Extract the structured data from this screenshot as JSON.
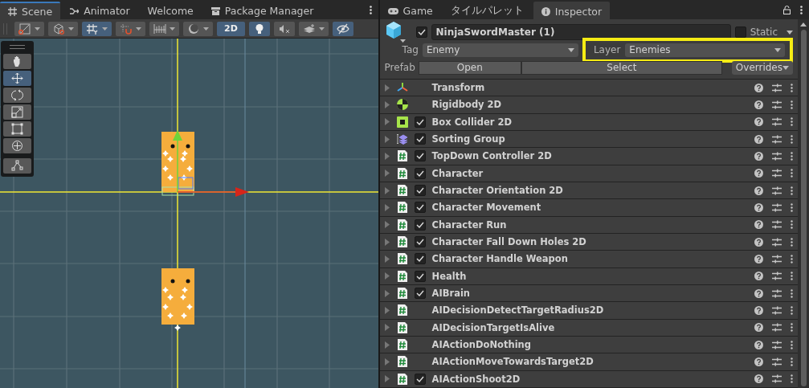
{
  "scene_panel": {
    "tabs": [
      {
        "label": "Scene",
        "kind": "grid",
        "selected": true
      },
      {
        "label": "Animator",
        "kind": "animator",
        "selected": false
      },
      {
        "label": "Welcome",
        "kind": "plain",
        "selected": false
      },
      {
        "label": "Package Manager",
        "kind": "package",
        "selected": false
      }
    ],
    "toolbar": [
      {
        "kind": "draw-mode",
        "selected": false
      },
      {
        "kind": "gizmo-cube",
        "selected": false
      },
      {
        "kind": "grid-snap",
        "selected": true
      },
      {
        "kind": "increment-snap",
        "selected": false
      },
      {
        "kind": "ruler",
        "selected": false
      },
      {
        "kind": "shading",
        "selected": false
      },
      {
        "kind": "mode",
        "label": "2D",
        "selected": true
      },
      {
        "kind": "lighting",
        "selected": true
      },
      {
        "kind": "audio",
        "selected": false
      },
      {
        "kind": "effects",
        "selected": false
      },
      {
        "kind": "visibility",
        "selected": true
      }
    ],
    "tools": [
      {
        "kind": "hand",
        "selected": false
      },
      {
        "kind": "move",
        "selected": true
      },
      {
        "kind": "rotate",
        "selected": false
      },
      {
        "kind": "scale",
        "selected": false
      },
      {
        "kind": "rect",
        "selected": false
      },
      {
        "kind": "transform",
        "selected": false
      },
      {
        "kind": "custom",
        "selected": false
      }
    ]
  },
  "inspector_panel": {
    "tabs": [
      {
        "label": "Game",
        "kind": "game",
        "selected": false
      },
      {
        "label": "タイルパレット",
        "kind": "plain",
        "selected": false
      },
      {
        "label": "Inspector",
        "kind": "info",
        "selected": true
      }
    ],
    "object": {
      "active": true,
      "name": "NinjaSwordMaster (1)",
      "static": false,
      "static_label": "Static",
      "tag_label": "Tag",
      "tag": "Enemy",
      "layer_label": "Layer",
      "layer": "Enemies",
      "layer_highlighted": true,
      "prefab_label": "Prefab",
      "open_button": "Open",
      "select_button": "Select",
      "overrides": "Overrides"
    },
    "components": [
      {
        "name": "Transform",
        "kind": "transform",
        "checked": false
      },
      {
        "name": "Rigidbody 2D",
        "kind": "rigidbody",
        "checked": false
      },
      {
        "name": "Box Collider 2D",
        "kind": "collider",
        "checked": true
      },
      {
        "name": "Sorting Group",
        "kind": "sorting",
        "checked": true
      },
      {
        "name": "TopDown Controller 2D",
        "kind": "script",
        "checked": true
      },
      {
        "name": "Character",
        "kind": "script",
        "checked": true
      },
      {
        "name": "Character Orientation 2D",
        "kind": "script",
        "checked": true
      },
      {
        "name": "Character Movement",
        "kind": "script",
        "checked": true
      },
      {
        "name": "Character Run",
        "kind": "script",
        "checked": true
      },
      {
        "name": "Character Fall Down Holes 2D",
        "kind": "script",
        "checked": true
      },
      {
        "name": "Character Handle Weapon",
        "kind": "script",
        "checked": true
      },
      {
        "name": "Health",
        "kind": "script",
        "checked": true
      },
      {
        "name": "AIBrain",
        "kind": "script",
        "checked": true
      },
      {
        "name": "AIDecisionDetectTargetRadius2D",
        "kind": "script",
        "checked": false
      },
      {
        "name": "AIDecisionTargetIsAlive",
        "kind": "script",
        "checked": false
      },
      {
        "name": "AIActionDoNothing",
        "kind": "script",
        "checked": false
      },
      {
        "name": "AIActionMoveTowardsTarget2D",
        "kind": "script",
        "checked": false
      },
      {
        "name": "AIActionShoot2D",
        "kind": "script",
        "checked": true
      }
    ]
  }
}
